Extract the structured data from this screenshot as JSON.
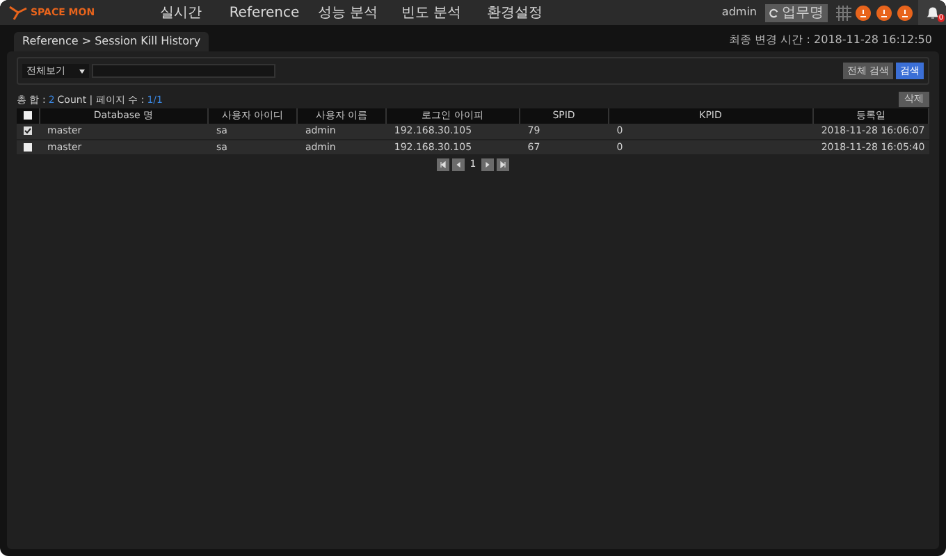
{
  "header": {
    "logo": "SPACE MON",
    "menu": [
      {
        "label": "실시간"
      },
      {
        "label": "Reference"
      },
      {
        "label": "성능 분석"
      },
      {
        "label": "빈도 분석"
      },
      {
        "label": "환경설정"
      }
    ],
    "user": "admin",
    "run_button": "업무명",
    "notification_count": "0"
  },
  "tab": {
    "label": "Reference > Session Kill History"
  },
  "last_changed": "최종 변경 시간 : 2018-11-28 16:12:50",
  "filter": {
    "select": "전체보기",
    "search_all_button": "전체 검색",
    "search_button": "검색"
  },
  "summary": {
    "prefix": "총 합 :",
    "count": "2",
    "count_label": "Count | 페이지 수 :",
    "pages": "1/1"
  },
  "delete_button": "삭제",
  "table": {
    "select_all_checked": false,
    "columns": [
      "Database 명",
      "사용자 아이디",
      "사용자 이름",
      "로그인 아이피",
      "SPID",
      "KPID",
      "등록일"
    ],
    "rows": [
      {
        "checked": true,
        "cells": [
          "master",
          "sa",
          "admin",
          "192.168.30.105",
          "79",
          "0",
          "2018-11-28 16:06:07"
        ]
      },
      {
        "checked": false,
        "cells": [
          "master",
          "sa",
          "admin",
          "192.168.30.105",
          "67",
          "0",
          "2018-11-28 16:05:40"
        ]
      }
    ]
  },
  "pagination": {
    "page": "1"
  }
}
